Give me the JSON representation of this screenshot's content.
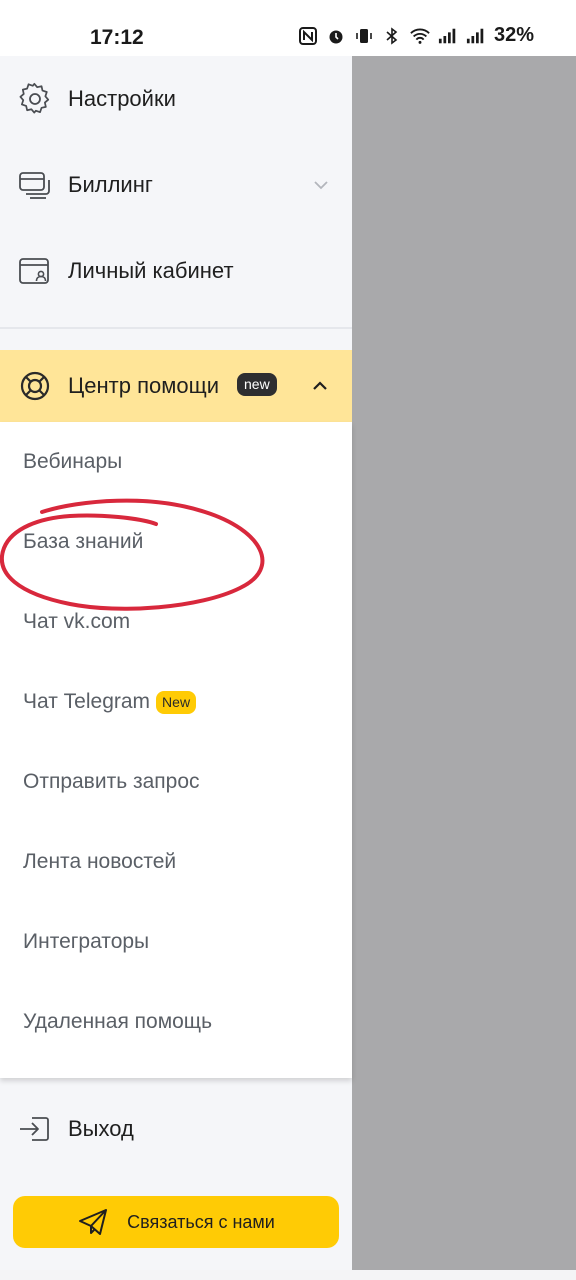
{
  "status_bar": {
    "time": "17:12",
    "battery": "32%",
    "icons": [
      "nfc-icon",
      "alarm-icon",
      "vibrate-icon",
      "bluetooth-icon",
      "wifi-icon",
      "signal-icon",
      "signal-icon"
    ]
  },
  "menu": {
    "items": [
      {
        "label": "Настройки",
        "icon": "gear-icon"
      },
      {
        "label": "Биллинг",
        "icon": "cards-icon"
      },
      {
        "label": "Личный кабинет",
        "icon": "account-icon"
      }
    ],
    "help_center": {
      "label": "Центр помощи",
      "badge": "new",
      "icon": "lifebuoy-icon"
    },
    "submenu": [
      {
        "label": "Вебинары"
      },
      {
        "label": "База знаний"
      },
      {
        "label": "Чат vk.com"
      },
      {
        "label": "Чат Telegram",
        "badge": "New"
      },
      {
        "label": "Отправить запрос"
      },
      {
        "label": "Лента новостей"
      },
      {
        "label": "Интеграторы"
      },
      {
        "label": "Удаленная помощь"
      }
    ],
    "logout": {
      "label": "Выход",
      "icon": "logout-icon"
    }
  },
  "contact_button": {
    "label": "Связаться с нами",
    "icon": "paper-plane-icon"
  },
  "colors": {
    "accent": "#ffcb05",
    "help_header_bg": "#ffe598",
    "drawer_bg": "#f5f6f9",
    "overlay": "#a9a9ab",
    "annotation": "#d8283c"
  }
}
